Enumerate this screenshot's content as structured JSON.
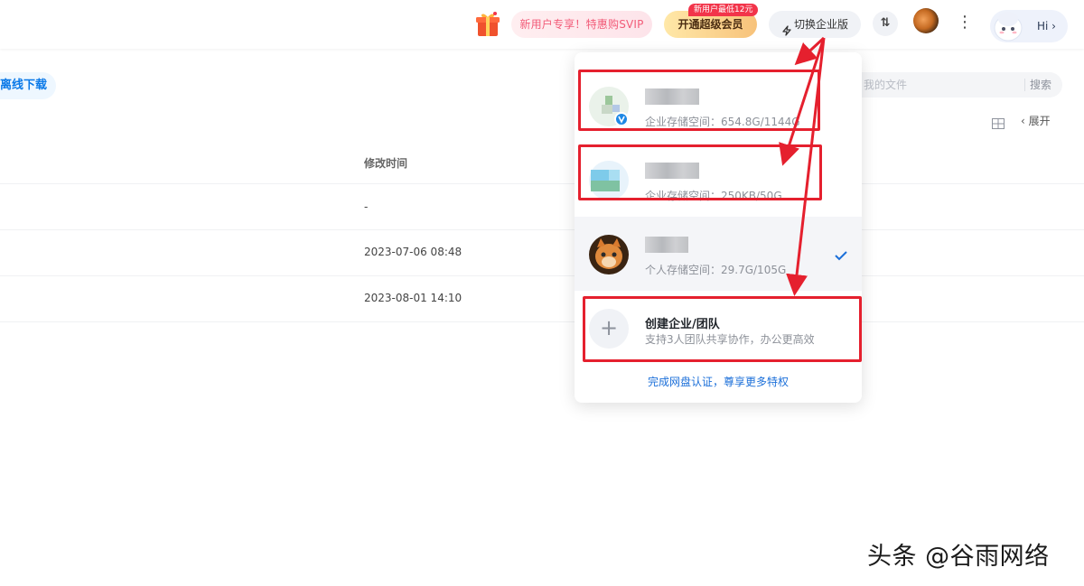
{
  "header": {
    "promo_text": "新用户专享！特惠购SVIP",
    "svip_button": "开通超级会员",
    "svip_badge": "新用户最低12元",
    "switch_button": "切换企业版",
    "transfer_icon_text": "⇅",
    "more_icon_text": "⋮",
    "hi_text": "Hi ›"
  },
  "toolbar": {
    "offline_download": "离线下载",
    "search_placeholder": "我的文件",
    "search_button": "搜索",
    "expand_label": "‹  展开"
  },
  "file_table": {
    "modified_header": "修改时间",
    "rows": [
      {
        "modified": "-"
      },
      {
        "modified": "2023-07-06 08:48"
      },
      {
        "modified": "2023-08-01 14:10"
      }
    ]
  },
  "dropdown": {
    "accounts": [
      {
        "storage": "企业存储空间：654.8G/1144G",
        "type": "enterprise",
        "verified": true
      },
      {
        "storage": "企业存储空间：250KB/50G",
        "type": "enterprise",
        "verified": false
      },
      {
        "storage": "个人存储空间：29.7G/105G",
        "type": "personal",
        "selected": true
      }
    ],
    "create": {
      "title": "创建企业/团队",
      "subtitle": "支持3人团队共享协作，办公更高效",
      "plus": "+"
    },
    "verify_link": "完成网盘认证，尊享更多特权"
  },
  "watermark": "头条 @谷雨网络",
  "colors": {
    "annotation_red": "#e5202e",
    "link_blue": "#1b6fd9",
    "promo_pink": "#f25b78",
    "svip_gold": "#f7c27a"
  }
}
